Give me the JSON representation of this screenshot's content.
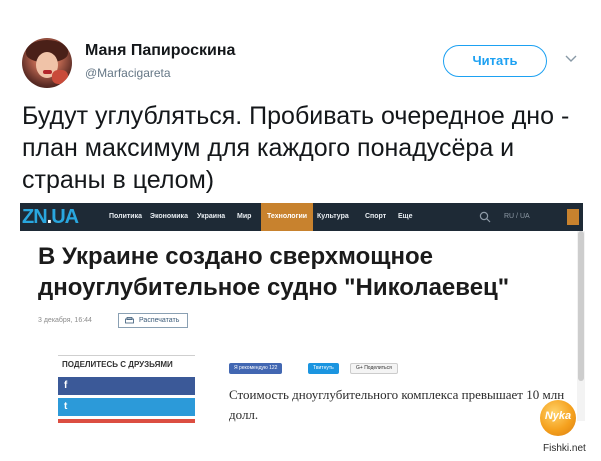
{
  "tweet": {
    "author_name": "Маня Папироскина",
    "author_handle": "@Marfacigareta",
    "follow_label": "Читать",
    "text": "Будут углубляться. Пробивать очередное дно - план максимум для каждого понадусёра и страны в целом)"
  },
  "screenshot": {
    "logo_main": "ZN",
    "logo_dot": ".",
    "logo_ua": "UA",
    "nav_items": [
      "Политика",
      "Экономика",
      "Украина",
      "Мир",
      "Технологии",
      "Культура",
      "Спорт",
      "Еще"
    ],
    "active_item": "Технологии",
    "lang": "RU / UA",
    "headline": "В Украине создано сверхмощное дноуглубительное судно \"Николаевец\"",
    "date": "3 декабря, 16:44",
    "print_label": "Распечатать",
    "share_title": "ПОДЕЛИТЕСЬ С ДРУЗЬЯМИ",
    "share_fb_glyph": "f",
    "share_tw_glyph": "t",
    "mini_fb_label": "Я рекомендую 122",
    "mini_tw_label": "Твитнуть",
    "mini_gp_label": "G+ Поделиться",
    "lead": "Стоимость дноуглубительного комплекса превышает 10 млн долл."
  },
  "badge_text": "Nyka",
  "watermark": "Fishki.net",
  "colors": {
    "twitter_blue": "#1da1f2",
    "nav_bg": "#1e2a36",
    "accent_orange": "#c8822e",
    "logo_blue": "#29a7df",
    "facebook": "#3b5998"
  }
}
